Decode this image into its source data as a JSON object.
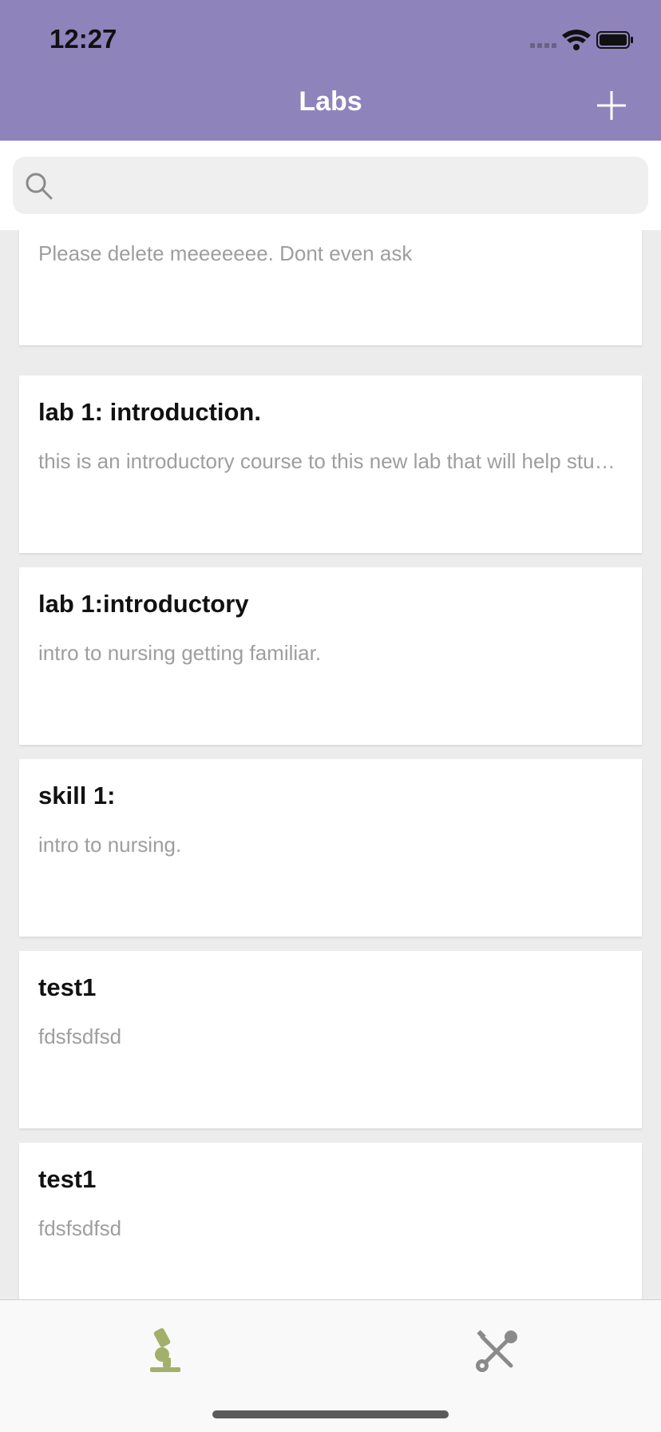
{
  "status_bar": {
    "time": "12:27"
  },
  "nav": {
    "title": "Labs",
    "add_icon": "plus-icon"
  },
  "search": {
    "placeholder": "",
    "value": "",
    "icon": "search-icon"
  },
  "labs": [
    {
      "title": "",
      "description": "Please delete meeeeeee. Dont even ask"
    },
    {
      "title": "lab 1: introduction.",
      "description": "this is an introductory course to this new lab that will help students learn more about the lab"
    },
    {
      "title": "lab 1:introductory",
      "description": "intro to nursing getting familiar."
    },
    {
      "title": "skill 1:",
      "description": "intro to nursing."
    },
    {
      "title": "test1",
      "description": "fdsfsdfsd"
    },
    {
      "title": "test1",
      "description": "fdsfsdfsd"
    }
  ],
  "tabs": [
    {
      "icon": "microscope-icon",
      "selected": true,
      "color": "#a3b06b"
    },
    {
      "icon": "tools-icon",
      "selected": false,
      "color": "#8a8a8a"
    }
  ],
  "colors": {
    "header": "#8f83bc",
    "accent": "#a3b06b"
  }
}
